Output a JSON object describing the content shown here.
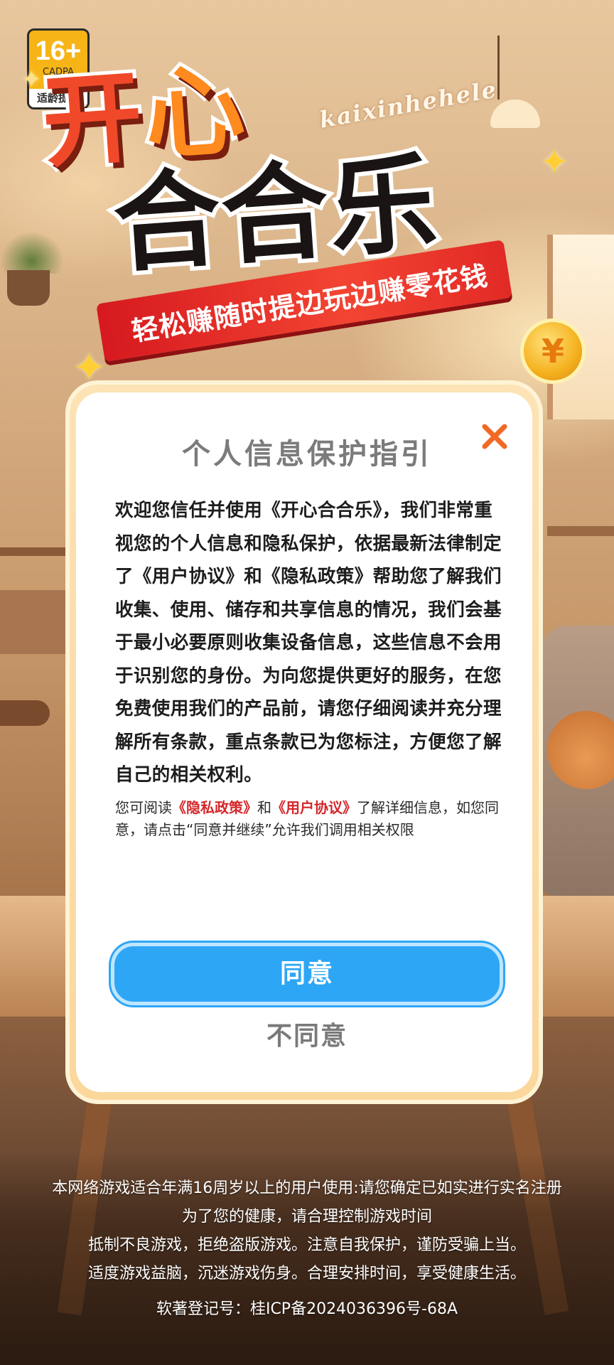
{
  "age_badge": {
    "age": "16+",
    "org": "CADPA",
    "hint": "适龄提示"
  },
  "logo": {
    "line1_a": "开",
    "line1_b": "心",
    "line2": "合合乐",
    "pinyin": "kaixinhehele",
    "slogan": "轻松赚随时提边玩边赚零花钱",
    "coin_symbol": "¥"
  },
  "dialog": {
    "title": "个人信息保护指引",
    "close_icon": "close-icon",
    "close_glyph": "✕",
    "body": "欢迎您信任并使用《开心合合乐》，我们非常重视您的个人信息和隐私保护，依据最新法律制定了《用户协议》和《隐私政策》帮助您了解我们收集、使用、储存和共享信息的情况，我们会基于最小必要原则收集设备信息，这些信息不会用于识别您的身份。为向您提供更好的服务，在您免费使用我们的产品前，请您仔细阅读并充分理解所有条款，重点条款已为您标注，方便您了解自己的相关权利。",
    "note_prefix": "您可阅读",
    "privacy_link": "《隐私政策》",
    "note_and": "和",
    "user_agreement_link": "《用户协议》",
    "note_suffix": "了解详细信息，如您同意，请点击“同意并继续”允许我们调用相关权限",
    "agree_label": "同意",
    "disagree_label": "不同意"
  },
  "footer": {
    "line1": "本网络游戏适合年满16周岁以上的用户使用:请您确定已如实进行实名注册",
    "line2": "为了您的健康，请合理控制游戏时间",
    "line3": "抵制不良游戏，拒绝盗版游戏。注意自我保护，谨防受骗上当。",
    "line4": "适度游戏益脑，沉迷游戏伤身。合理安排时间，享受健康生活。",
    "registration": "软著登记号：桂ICP备2024036396号-68A"
  },
  "colors": {
    "agree_button": "#2ea6f6",
    "link_red": "#d4262a",
    "close_orange": "#f06a25",
    "logo_red": "#f0492a",
    "ribbon_red": "#e22a26"
  }
}
